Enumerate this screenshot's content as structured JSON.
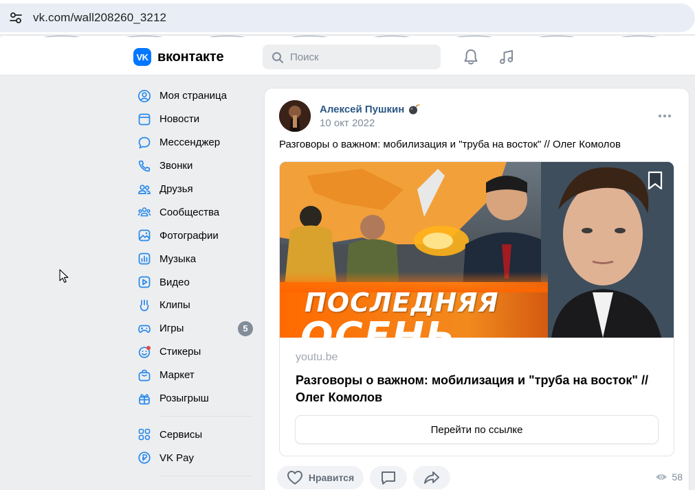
{
  "browser": {
    "url": "vk.com/wall208260_3212"
  },
  "header": {
    "logo_mark": "VK",
    "logo_text": "вконтакте",
    "search_placeholder": "Поиск",
    "icons": [
      "bell-icon",
      "music-icon"
    ]
  },
  "nav": {
    "items": [
      {
        "label": "Моя страница",
        "icon": "user-circle-icon"
      },
      {
        "label": "Новости",
        "icon": "news-icon"
      },
      {
        "label": "Мессенджер",
        "icon": "message-icon"
      },
      {
        "label": "Звонки",
        "icon": "phone-icon"
      },
      {
        "label": "Друзья",
        "icon": "friends-icon"
      },
      {
        "label": "Сообщества",
        "icon": "communities-icon"
      },
      {
        "label": "Фотографии",
        "icon": "photo-icon"
      },
      {
        "label": "Музыка",
        "icon": "music-icon"
      },
      {
        "label": "Видео",
        "icon": "video-icon"
      },
      {
        "label": "Клипы",
        "icon": "clips-icon"
      },
      {
        "label": "Игры",
        "icon": "gamepad-icon",
        "badge": "5"
      },
      {
        "label": "Стикеры",
        "icon": "sticker-icon"
      },
      {
        "label": "Маркет",
        "icon": "market-icon"
      },
      {
        "label": "Розыгрыш",
        "icon": "gift-icon"
      }
    ],
    "extra": [
      {
        "label": "Сервисы",
        "icon": "services-icon"
      },
      {
        "label": "VK Pay",
        "icon": "vkpay-icon"
      }
    ]
  },
  "post": {
    "author": "Алексей Пушкин",
    "date": "10 окт 2022",
    "text": "Разговоры о важном: мобилизация и \"труба на восток\" // Олег Комолов",
    "attachment": {
      "thumb_line1": "ПОСЛЕДНЯЯ",
      "thumb_line2": "ОСЕНЬ",
      "domain": "youtu.be",
      "title": "Разговоры о важном: мобилизация и \"труба на восток\" // Олег Комолов",
      "button": "Перейти по ссылке"
    },
    "actions": {
      "like_label": "Нравится",
      "views": "58"
    }
  },
  "colors": {
    "accent": "#2688eb",
    "link": "#2a5885",
    "page_bg": "#edeef0"
  }
}
